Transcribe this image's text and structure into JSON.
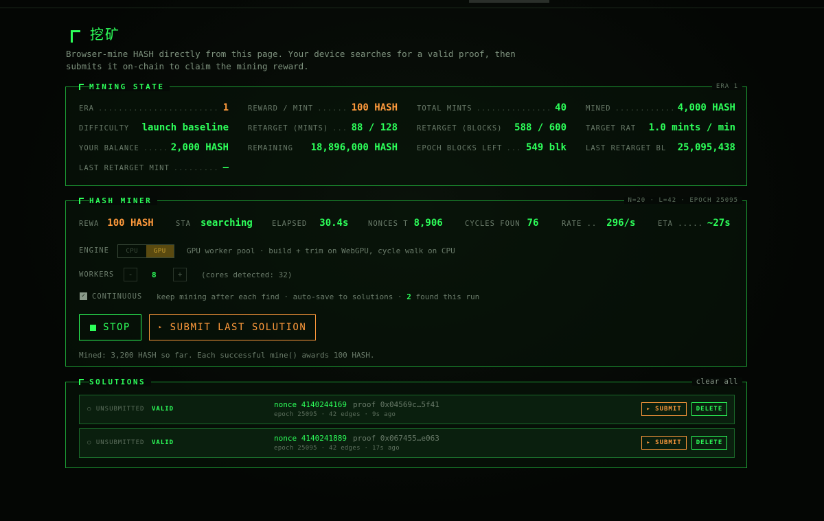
{
  "page": {
    "title": "挖矿",
    "intro_line1": "Browser-mine HASH directly from this page. Your device searches for a valid proof, then",
    "intro_line2": "submits it on-chain to claim the mining reward."
  },
  "mining_state": {
    "title": "MINING STATE",
    "era_tag": "ERA 1",
    "cells": [
      {
        "label": "ERA",
        "value": "1",
        "accent": "orange"
      },
      {
        "label": "REWARD / MINT",
        "value": "100 HASH",
        "accent": "orange"
      },
      {
        "label": "TOTAL MINTS",
        "value": "40",
        "accent": "green"
      },
      {
        "label": "MINED",
        "value": "4,000 HASH",
        "accent": "green"
      },
      {
        "label": "DIFFICULTY",
        "value": "launch baseline",
        "accent": "green"
      },
      {
        "label": "RETARGET (MINTS)",
        "value": "88 / 128",
        "accent": "green"
      },
      {
        "label": "RETARGET (BLOCKS)",
        "value": "588 / 600",
        "accent": "green"
      },
      {
        "label": "TARGET RAT",
        "value": "1.0 mints / min",
        "accent": "green"
      },
      {
        "label": "YOUR BALANCE",
        "value": "2,000 HASH",
        "accent": "green"
      },
      {
        "label": "REMAINING",
        "value": "18,896,000 HASH",
        "accent": "green"
      },
      {
        "label": "EPOCH BLOCKS LEFT",
        "value": "549 blk",
        "accent": "green"
      },
      {
        "label": "LAST RETARGET BL",
        "value": "25,095,438",
        "accent": "green"
      },
      {
        "label": "LAST RETARGET MINT",
        "value": "—",
        "accent": "green"
      }
    ]
  },
  "hash_miner": {
    "title": "HASH MINER",
    "meta": "N=20 · L=42 · EPOCH 25095",
    "stats": [
      {
        "label": "REWA",
        "value": "100 HASH",
        "accent": "orange"
      },
      {
        "label": "STA",
        "value": "searching",
        "accent": "green"
      },
      {
        "label": "ELAPSED",
        "value": "30.4s",
        "accent": "green"
      },
      {
        "label": "NONCES T",
        "value": "8,906",
        "accent": "green"
      },
      {
        "label": "CYCLES FOUN",
        "value": "76",
        "accent": "green"
      },
      {
        "label": "RATE ..",
        "value": "296/s",
        "accent": "green"
      },
      {
        "label": "ETA .....",
        "value": "~27s",
        "accent": "green"
      }
    ],
    "engine_label": "ENGINE",
    "engine_cpu": "CPU",
    "engine_gpu": "GPU",
    "engine_desc": "GPU worker pool · build + trim on WebGPU, cycle walk on CPU",
    "workers_label": "WORKERS",
    "workers_minus": "-",
    "workers_value": "8",
    "workers_plus": "+",
    "cores": "(cores detected: 32)",
    "continuous_label": "CONTINUOUS",
    "continuous_desc_pre": "keep mining after each find · auto-save to solutions · ",
    "continuous_count": "2",
    "continuous_desc_post": " found this run",
    "stop_label": "STOP",
    "submit_label": "SUBMIT LAST SOLUTION",
    "mined_line": "Mined: 3,200 HASH so far. Each successful mine() awards 100 HASH."
  },
  "solutions": {
    "title": "SOLUTIONS",
    "clear_label": "clear all",
    "rows": [
      {
        "status": "○ UNSUBMITTED",
        "validity": "VALID",
        "nonce": "nonce 4140244169",
        "proof": "proof 0x04569c…5f41",
        "sub": "epoch 25095 · 42 edges · 9s ago",
        "submit": "▸ SUBMIT",
        "delete": "DELETE"
      },
      {
        "status": "○ UNSUBMITTED",
        "validity": "VALID",
        "nonce": "nonce 4140241889",
        "proof": "proof 0x067455…e063",
        "sub": "epoch 25095 · 42 edges · 17s ago",
        "submit": "▸ SUBMIT",
        "delete": "DELETE"
      }
    ]
  },
  "colors": {
    "accent": "#2dff5a",
    "warn": "#ff9a3c",
    "muted": "#6a7b6a"
  }
}
